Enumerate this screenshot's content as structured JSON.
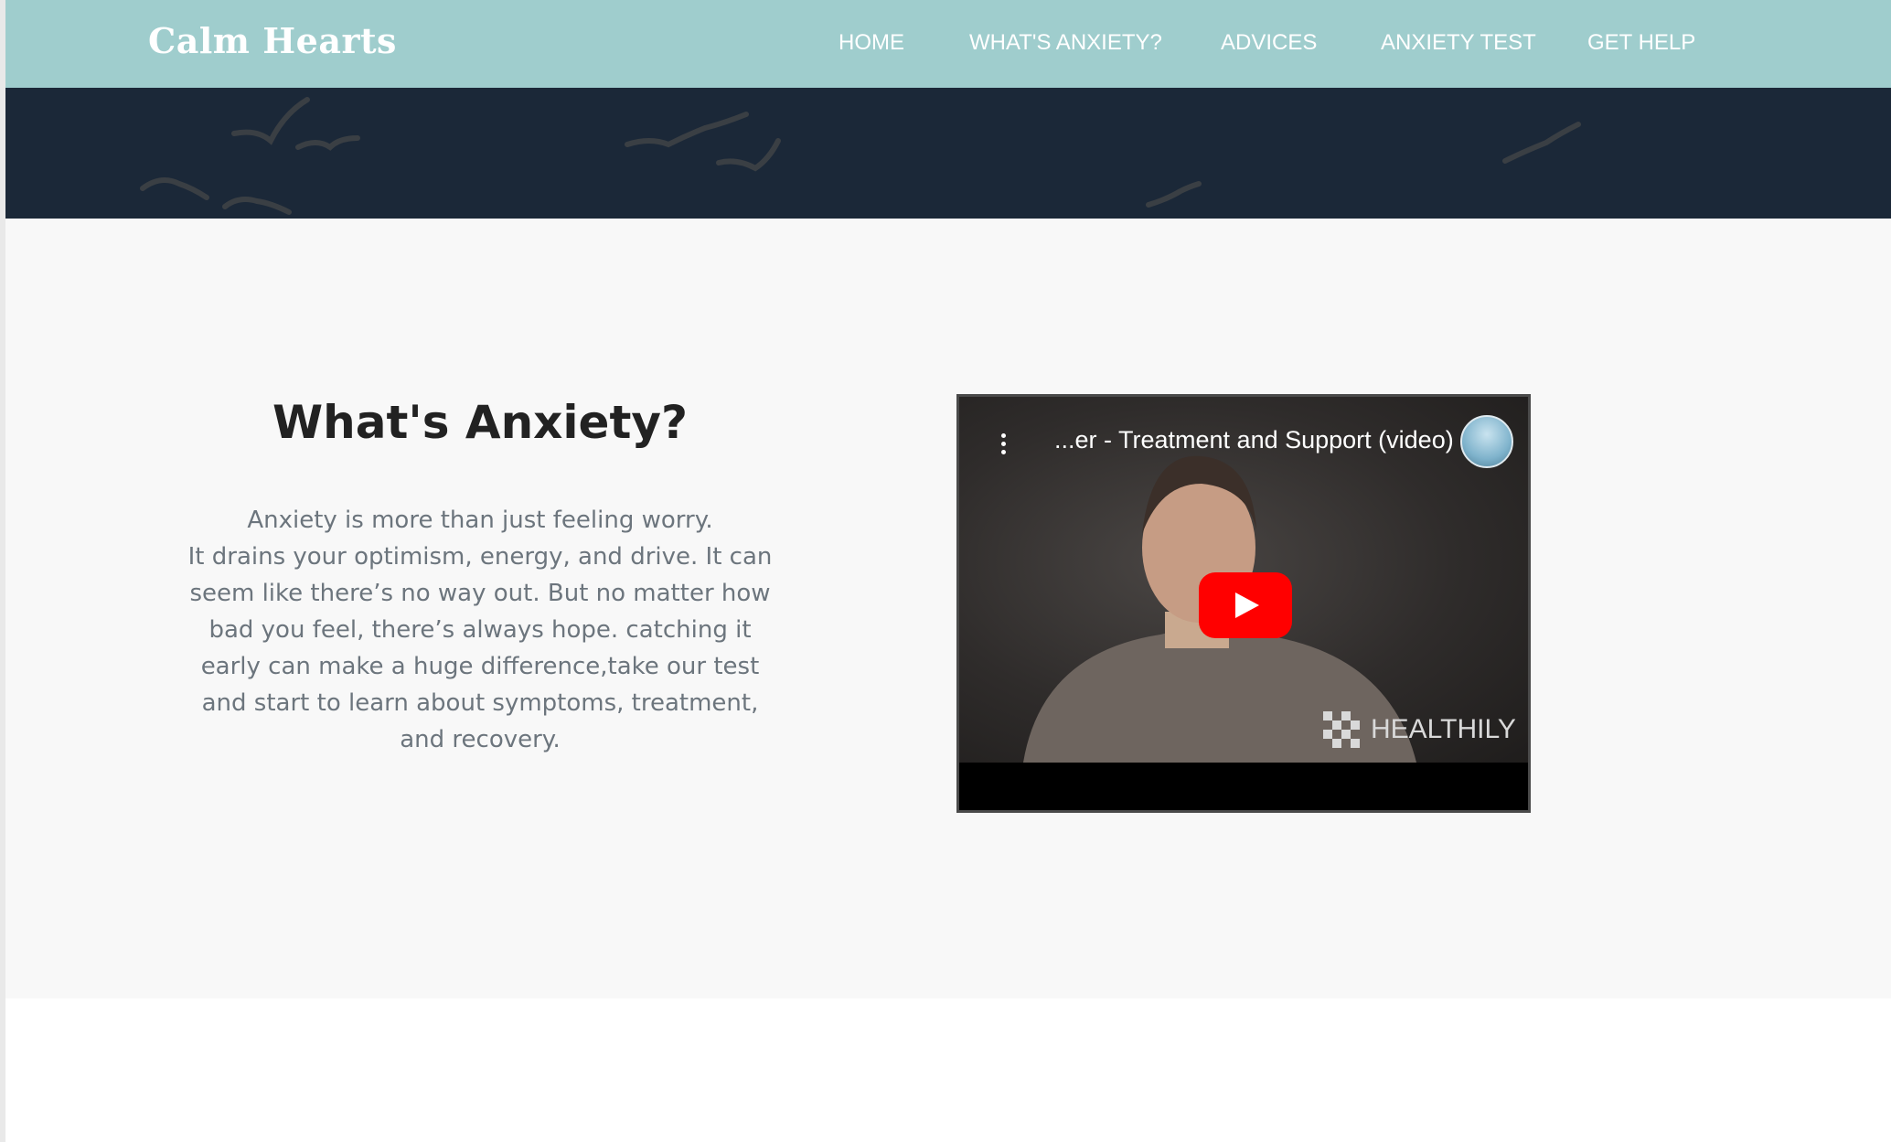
{
  "brand": {
    "name": "Calm Hearts"
  },
  "nav": {
    "items": [
      {
        "label": "HOME"
      },
      {
        "label": "WHAT'S ANXIETY?"
      },
      {
        "label": "ADVICES"
      },
      {
        "label": "ANXIETY TEST"
      },
      {
        "label": "GET HELP"
      }
    ]
  },
  "colors": {
    "navbar": "#9fcdcd",
    "hero": "#1b2838",
    "content_bg": "#f8f8f8",
    "heading": "#222222",
    "body_text": "#6c757d",
    "youtube_red": "#ff0000"
  },
  "main": {
    "heading": "What's Anxiety?",
    "description_lines": [
      "Anxiety is more than just feeling worry.",
      "It drains your optimism, energy, and drive. It can",
      "seem like there’s no way out. But no matter how",
      "bad you feel, there’s always hope. catching it",
      "early can make a huge difference,take our test",
      "and start to learn about symptoms, treatment,",
      "and recovery."
    ]
  },
  "video": {
    "title": "...er - Treatment and Support (video)",
    "watermark": "HEALTHILY",
    "icons": {
      "menu": "more-vert-icon",
      "play": "play-icon",
      "avatar": "channel-avatar"
    }
  }
}
